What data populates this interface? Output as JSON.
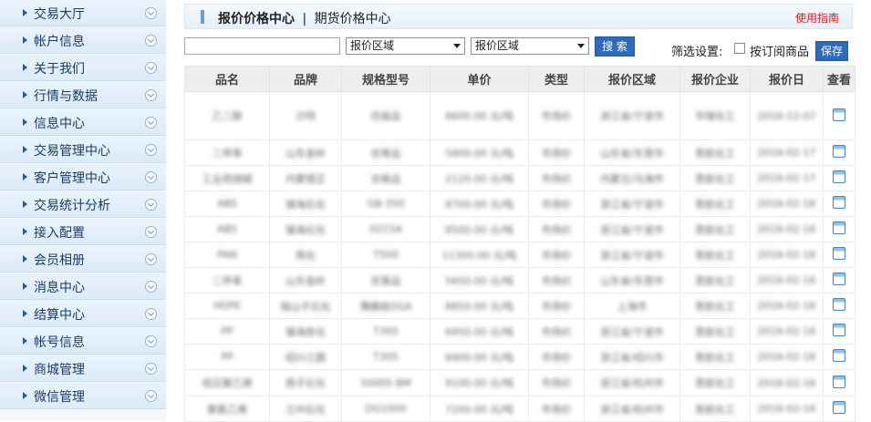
{
  "sidebar": {
    "items": [
      {
        "label": "交易大厅"
      },
      {
        "label": "帐户信息"
      },
      {
        "label": "关于我们"
      },
      {
        "label": "行情与数据"
      },
      {
        "label": "信息中心"
      },
      {
        "label": "交易管理中心"
      },
      {
        "label": "客户管理中心"
      },
      {
        "label": "交易统计分析"
      },
      {
        "label": "接入配置"
      },
      {
        "label": "会员相册"
      },
      {
        "label": "消息中心"
      },
      {
        "label": "结算中心"
      },
      {
        "label": "帐号信息"
      },
      {
        "label": "商城管理"
      },
      {
        "label": "微信管理"
      }
    ]
  },
  "header": {
    "title_main": "报价价格中心",
    "separator": "|",
    "title_sub": "期货价格中心",
    "help_link": "使用指南"
  },
  "filters": {
    "search_value": "",
    "region1": "报价区域",
    "region2": "报价区域",
    "search_button": "搜 索",
    "settings_label": "筛选设置:",
    "subscribe_label": "按订阅商品",
    "save_button": "保存"
  },
  "table": {
    "headers": [
      "品名",
      "品牌",
      "规格型号",
      "单价",
      "类型",
      "报价区域",
      "报价企业",
      "报价日",
      "查看"
    ],
    "rows": [
      [
        "乙二醇",
        "沙特",
        "优级品",
        "6600.00 元/吨",
        "市场价",
        "浙江省/宁波市",
        "华瑞化工",
        "2016-12-07"
      ],
      [
        "二甲苯",
        "山东金岭",
        "优等品",
        "5800.00 元/吨",
        "市场价",
        "山东省/东营市",
        "思航化工",
        "2016-02-17"
      ],
      [
        "工业用烧碱",
        "内蒙德正",
        "合格品",
        "2120.00 元/吨",
        "市场价",
        "内蒙古/乌海市",
        "思航化工",
        "2016-02-17"
      ],
      [
        "ABS",
        "镇海石化",
        "GB-350",
        "8700.00 元/吨",
        "市场价",
        "浙江省/宁波市",
        "思航化工",
        "2016-02-16"
      ],
      [
        "ABS",
        "镇海石化",
        "0215A",
        "8500.00 元/吨",
        "市场价",
        "浙江省/宁波市",
        "思航化工",
        "2016-02-16"
      ],
      [
        "PAN",
        "燕化",
        "T500",
        "11300.00 元/吨",
        "市场价",
        "浙江省/宁波市",
        "思航化工",
        "2016-02-16"
      ],
      [
        "二甲苯",
        "山东金岭",
        "优等品",
        "5650.00 元/吨",
        "市场价",
        "山东省/东营市",
        "思航化工",
        "2016-02-16"
      ],
      [
        "HDPE",
        "独山子石化",
        "薄膜级DGA",
        "8850.00 元/吨",
        "市场价",
        "上海市",
        "思航化工",
        "2016-02-16"
      ],
      [
        "PP",
        "镇海炼化",
        "T30S",
        "6950.00 元/吨",
        "市场价",
        "浙江省/宁波市",
        "思航化工",
        "2016-02-16"
      ],
      [
        "PP",
        "绍兴三圆",
        "T30S",
        "6900.00 元/吨",
        "市场价",
        "浙江省/绍兴市",
        "思航化工",
        "2016-02-16"
      ],
      [
        "低压聚乙烯",
        "扬子石化",
        "5000S BM",
        "9100.00 元/吨",
        "市场价",
        "浙江省/杭州市",
        "思航化工",
        "2016-02-16"
      ],
      [
        "聚氯乙烯",
        "兰州石化",
        "DG1000",
        "7200.00 元/吨",
        "市场价",
        "浙江省/杭州市",
        "思航化工",
        "2016-02-16"
      ]
    ]
  }
}
